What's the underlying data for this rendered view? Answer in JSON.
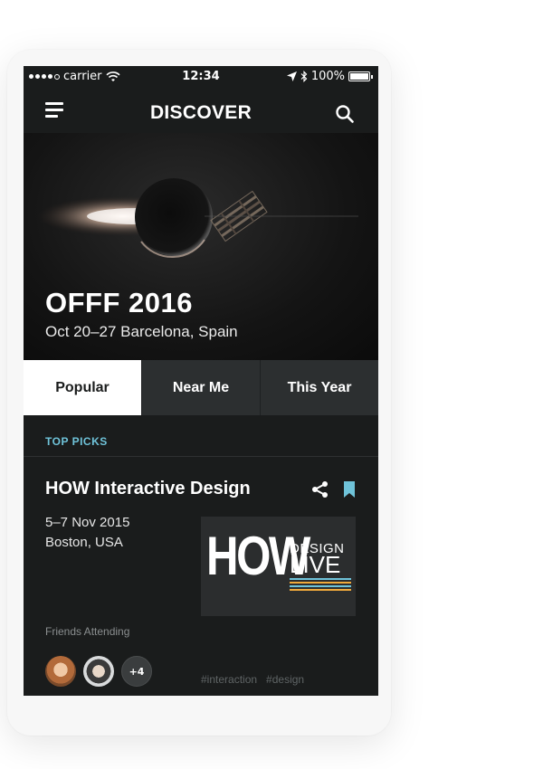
{
  "status_bar": {
    "carrier": "carrier",
    "time": "12:34",
    "battery": "100%"
  },
  "nav": {
    "title": "DISCOVER"
  },
  "hero": {
    "title": "OFFF 2016",
    "subtitle": "Oct 20–27  Barcelona, Spain"
  },
  "tabs": [
    {
      "label": "Popular",
      "active": true
    },
    {
      "label": "Near Me",
      "active": false
    },
    {
      "label": "This Year",
      "active": false
    }
  ],
  "section": {
    "label": "TOP PICKS"
  },
  "event": {
    "title": "HOW Interactive Design",
    "date": "5–7 Nov 2015",
    "location": "Boston, USA",
    "logo_how": "HOW",
    "logo_design": "DESIGN",
    "logo_live": "LIVE",
    "friends_label": "Friends Attending",
    "friends_more": "+4",
    "tags": [
      "#interaction",
      "#design"
    ]
  },
  "colors": {
    "background": "#1a1c1c",
    "accent": "#6fc3d9",
    "tab_inactive": "#2c2f30",
    "tab_active": "#ffffff",
    "logo_stripes": [
      "#6fc3d9",
      "#f0a93b",
      "#6fc3d9",
      "#f0a93b"
    ]
  },
  "icons": [
    "menu-icon",
    "search-icon",
    "wifi-icon",
    "location-arrow-icon",
    "bluetooth-icon",
    "battery-icon",
    "share-icon",
    "bookmark-icon"
  ]
}
